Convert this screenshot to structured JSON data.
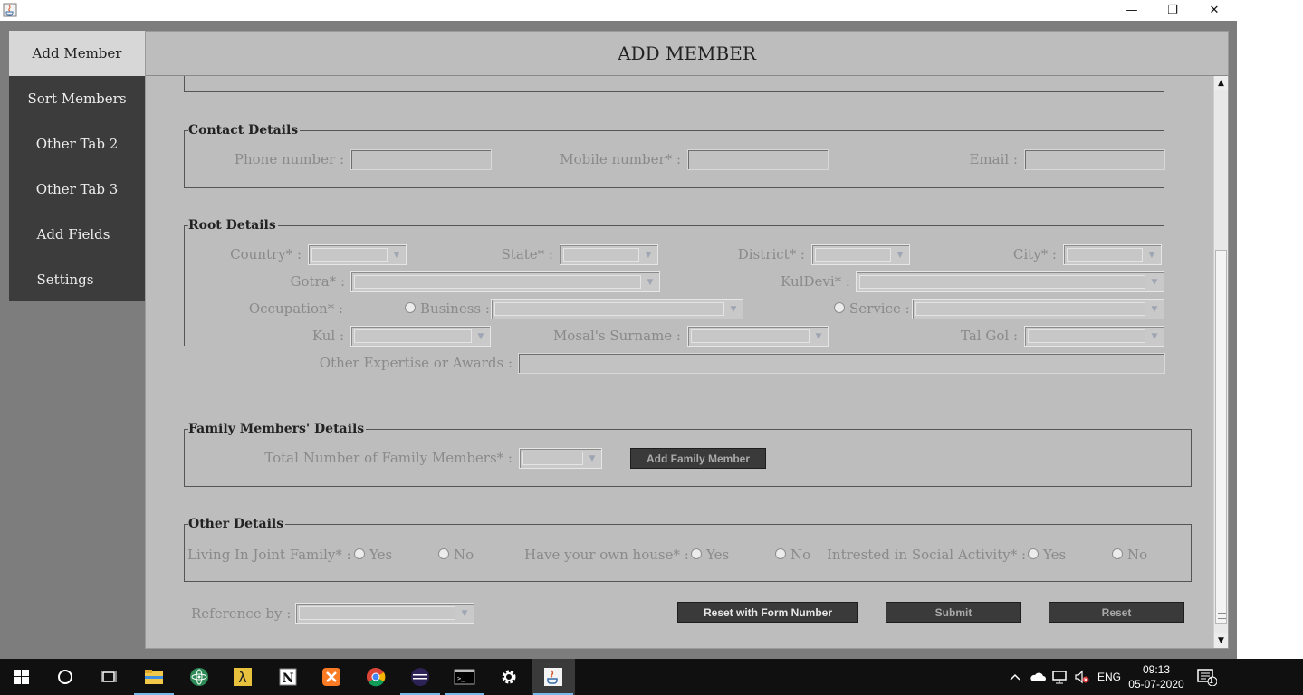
{
  "window": {
    "minimize": "—",
    "restore": "❐",
    "close": "✕"
  },
  "sidebar": {
    "items": [
      {
        "label": "Add Member"
      },
      {
        "label": "Sort Members"
      },
      {
        "label": "Other Tab 2"
      },
      {
        "label": "Other Tab 3"
      },
      {
        "label": "Add Fields"
      },
      {
        "label": "Settings"
      }
    ]
  },
  "header": {
    "title": "ADD MEMBER"
  },
  "contact": {
    "legend": "Contact Details",
    "phone_label": "Phone number :",
    "mobile_label": "Mobile number* :",
    "email_label": "Email :"
  },
  "root": {
    "legend": "Root Details",
    "country_label": "Country* :",
    "state_label": "State* :",
    "district_label": "District* :",
    "city_label": "City* :",
    "gotra_label": "Gotra* :",
    "kuldevi_label": "KulDevi* :",
    "occupation_label": "Occupation* :",
    "business_label": "Business :",
    "service_label": "Service :",
    "kul_label": "Kul :",
    "mosal_label": "Mosal's Surname :",
    "talgol_label": "Tal Gol :",
    "expertise_label": "Other Expertise or Awards :"
  },
  "family": {
    "legend": "Family Members' Details",
    "total_label": "Total Number of Family Members* :",
    "add_button": "Add Family Member"
  },
  "other": {
    "legend": "Other Details",
    "joint_label": "Living In Joint Family* :",
    "house_label": "Have your own house* :",
    "social_label": "Intrested in Social Activity* :",
    "yes": "Yes",
    "no": "No"
  },
  "footer": {
    "reference_label": "Reference by :",
    "reset_form_button": "Reset with Form Number",
    "submit_button": "Submit",
    "reset_button": "Reset"
  },
  "taskbar": {
    "language": "ENG",
    "time": "09:13",
    "date": "05-07-2020",
    "notification_count": "1"
  },
  "colors": {
    "panel_bg": "#bdbdbd",
    "sidebar_bg": "#3c3c3c",
    "window_bg": "#7d7d7d",
    "button_bg": "#3a3a3a",
    "taskbar_bg": "#101010"
  }
}
